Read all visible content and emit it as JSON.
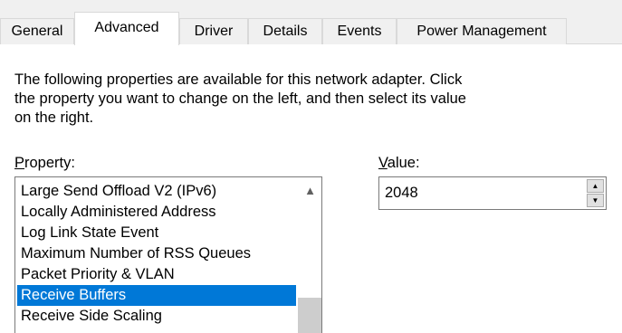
{
  "tabs": [
    {
      "label": "General",
      "active": false
    },
    {
      "label": "Advanced",
      "active": true
    },
    {
      "label": "Driver",
      "active": false
    },
    {
      "label": "Details",
      "active": false
    },
    {
      "label": "Events",
      "active": false
    },
    {
      "label": "Power Management",
      "active": false
    }
  ],
  "description": {
    "line1": "The following properties are available for this network adapter. Click",
    "line2": "the property you want to change on the left, and then select its value",
    "line3": "on the right."
  },
  "property": {
    "label_mnemonic": "P",
    "label_rest": "roperty:",
    "items": [
      "Large Send Offload V2 (IPv6)",
      "Locally Administered Address",
      "Log Link State Event",
      "Maximum Number of RSS Queues",
      "Packet Priority & VLAN",
      "Receive Buffers",
      "Receive Side Scaling"
    ],
    "selected": "Receive Buffers"
  },
  "value": {
    "label_mnemonic": "V",
    "label_rest": "alue:",
    "current": "2048"
  },
  "colors": {
    "selection": "#0078d7",
    "tabbar_bg": "#f0f0f0",
    "border": "#7a7a7a"
  },
  "icons": {
    "scroll_up": "▲",
    "spin_up": "▲",
    "spin_down": "▼"
  }
}
